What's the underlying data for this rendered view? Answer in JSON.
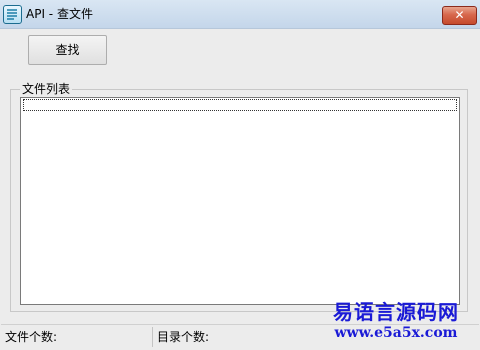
{
  "window": {
    "title": "API - 查文件",
    "close_symbol": "✕"
  },
  "toolbar": {
    "find_label": "查找"
  },
  "file_group": {
    "label": "文件列表"
  },
  "file_list": {
    "items": [
      ""
    ]
  },
  "status": {
    "file_count_label": "文件个数:",
    "dir_count_label": "目录个数:"
  },
  "watermark": {
    "name": "易语言源码网",
    "url": "www.e5a5x.com"
  },
  "icons": {
    "app": "app-icon",
    "close": "close-icon"
  }
}
